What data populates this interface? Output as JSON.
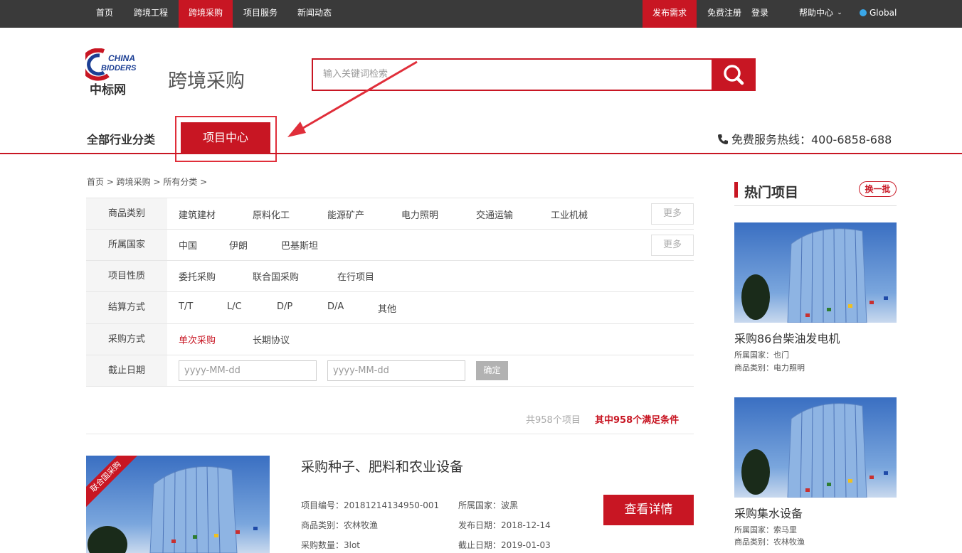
{
  "topbar": {
    "nav": [
      "首页",
      "跨境工程",
      "跨境采购",
      "项目服务",
      "新闻动态"
    ],
    "publish": "发布需求",
    "register": "免费注册",
    "login": "登录",
    "help": "帮助中心",
    "global": "Global"
  },
  "brand": {
    "logo_en_line1": "CHINA",
    "logo_en_line2": "BIDDERS",
    "logo_cn": "中标网"
  },
  "page_title": "跨境采购",
  "search": {
    "placeholder": "输入关键词检索"
  },
  "nav2": {
    "all_categories": "全部行业分类",
    "project_center": "项目中心",
    "hotline": "免费服务热线：400-6858-688"
  },
  "breadcrumb": "首页 > 跨境采购 > 所有分类 >",
  "filters": {
    "category": {
      "label": "商品类别",
      "options": [
        "建筑建材",
        "原料化工",
        "能源矿产",
        "电力照明",
        "交通运输",
        "工业机械"
      ],
      "more": "更多"
    },
    "country": {
      "label": "所属国家",
      "options": [
        "中国",
        "伊朗",
        "巴基斯坦"
      ],
      "more": "更多"
    },
    "nature": {
      "label": "项目性质",
      "options": [
        "委托采购",
        "联合国采购",
        "在行项目"
      ]
    },
    "settlement": {
      "label": "结算方式",
      "options": [
        "T/T",
        "L/C",
        "D/P",
        "D/A",
        "其他"
      ]
    },
    "method": {
      "label": "采购方式",
      "options": [
        "单次采购",
        "长期协议"
      ],
      "active": "单次采购"
    },
    "deadline": {
      "label": "截止日期",
      "from_placeholder": "yyyy-MM-dd",
      "to_placeholder": "yyyy-MM-dd",
      "confirm": "确定"
    }
  },
  "counts": {
    "total": "共958个项目",
    "matched": "其中958个满足条件"
  },
  "result": {
    "ribbon": "联合国采购",
    "title": "采购种子、肥料和农业设备",
    "project_no": "项目编号：20181214134950-001",
    "country": "所属国家：波黑",
    "category": "商品类别：农林牧渔",
    "publish_date": "发布日期：2018-12-14",
    "quantity": "采购数量：3lot",
    "deadline": "截止日期：2019-01-03",
    "detail_button": "查看详情"
  },
  "hot": {
    "title": "热门项目",
    "swap": "换一批",
    "items": [
      {
        "name": "采购86台柴油发电机",
        "country": "所属国家：也门",
        "category": "商品类别：电力照明"
      },
      {
        "name": "采购集水设备",
        "country": "所属国家：索马里",
        "category": "商品类别：农林牧渔"
      }
    ]
  },
  "colors": {
    "accent": "#c81623",
    "topbar": "#3a3a3a"
  }
}
